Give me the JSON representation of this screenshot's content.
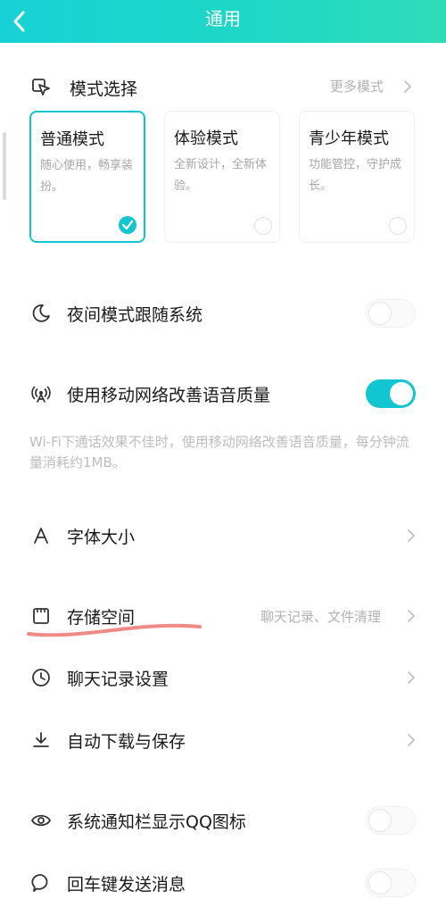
{
  "header": {
    "title": "通用"
  },
  "mode_section": {
    "title": "模式选择",
    "more_label": "更多模式",
    "modes": [
      {
        "title": "普通模式",
        "desc": "随心使用，畅享装扮。",
        "selected": true
      },
      {
        "title": "体验模式",
        "desc": "全新设计，全新体验。",
        "selected": false
      },
      {
        "title": "青少年模式",
        "desc": "功能管控，守护成长。",
        "selected": false
      }
    ]
  },
  "settings": {
    "night_mode": {
      "label": "夜间模式跟随系统",
      "enabled": false
    },
    "mobile_voice": {
      "label": "使用移动网络改善语音质量",
      "enabled": true,
      "description": "Wi-Fi下通话效果不佳时，使用移动网络改善语音质量，每分钟流量消耗约1MB。"
    },
    "font_size": {
      "label": "字体大小"
    },
    "storage": {
      "label": "存储空间",
      "hint": "聊天记录、文件清理"
    },
    "chat_history": {
      "label": "聊天记录设置"
    },
    "auto_download": {
      "label": "自动下载与保存"
    },
    "notif_icon": {
      "label": "系统通知栏显示QQ图标",
      "enabled": false
    },
    "enter_send": {
      "label": "回车键发送消息",
      "enabled": false
    }
  },
  "colors": {
    "accent": "#12c6d1",
    "header_start": "#18d1d6",
    "header_end": "#2fdcb8",
    "annotation": "#f08a86"
  },
  "icons": [
    "back-arrow-icon",
    "mode-select-icon",
    "moon-icon",
    "signal-antenna-icon",
    "font-a-icon",
    "storage-box-icon",
    "clock-icon",
    "download-icon",
    "eye-icon",
    "chat-bubble-icon",
    "chevron-right-icon",
    "check-icon"
  ]
}
